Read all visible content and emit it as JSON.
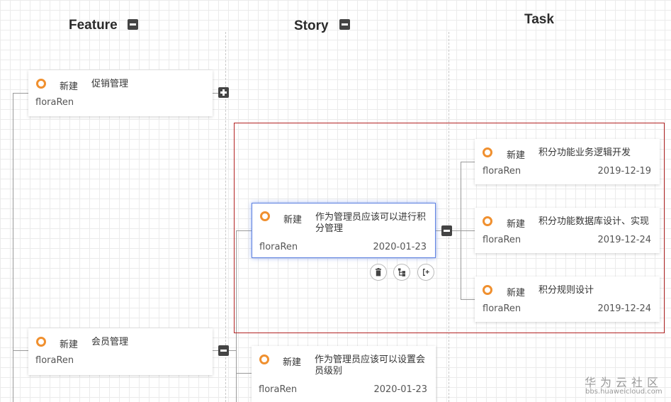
{
  "columns": {
    "feature": "Feature",
    "story": "Story",
    "task": "Task"
  },
  "features": [
    {
      "status": "新建",
      "title": "促销管理",
      "owner": "floraRen"
    },
    {
      "status": "新建",
      "title": "会员管理",
      "owner": "floraRen"
    }
  ],
  "stories": [
    {
      "status": "新建",
      "title": "作为管理员应该可以进行积分管理",
      "owner": "floraRen",
      "date": "2020-01-23"
    },
    {
      "status": "新建",
      "title": "作为管理员应该可以设置会员级别",
      "owner": "floraRen",
      "date": "2020-01-23"
    }
  ],
  "tasks": [
    {
      "status": "新建",
      "title": "积分功能业务逻辑开发",
      "owner": "floraRen",
      "date": "2019-12-19"
    },
    {
      "status": "新建",
      "title": "积分功能数据库设计、实现",
      "owner": "floraRen",
      "date": "2019-12-24"
    },
    {
      "status": "新建",
      "title": "积分规则设计",
      "owner": "floraRen",
      "date": "2019-12-24"
    }
  ],
  "actions": [
    "trash-icon",
    "tree-structure-icon",
    "add-child-icon"
  ],
  "colors": {
    "status_ring": "#f0902f",
    "selected_border": "#5b7fe0",
    "highlight_box": "#b22222"
  },
  "watermark": {
    "cn": "华为云社区",
    "en": "bbs.huaweicloud.com"
  }
}
